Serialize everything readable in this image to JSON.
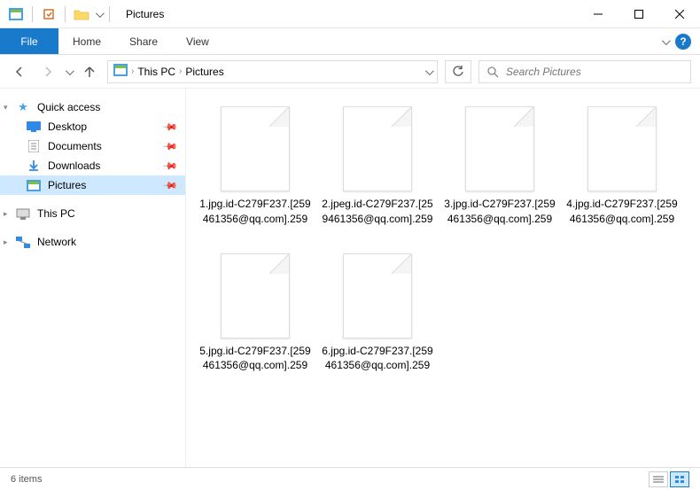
{
  "window": {
    "title": "Pictures"
  },
  "ribbon": {
    "file": "File",
    "tabs": [
      "Home",
      "Share",
      "View"
    ]
  },
  "breadcrumb": {
    "items": [
      "This PC",
      "Pictures"
    ]
  },
  "search": {
    "placeholder": "Search Pictures"
  },
  "sidebar": {
    "quick_access": "Quick access",
    "items": [
      {
        "icon": "desktop",
        "label": "Desktop",
        "pinned": true
      },
      {
        "icon": "documents",
        "label": "Documents",
        "pinned": true
      },
      {
        "icon": "downloads",
        "label": "Downloads",
        "pinned": true
      },
      {
        "icon": "pictures",
        "label": "Pictures",
        "pinned": true,
        "selected": true
      }
    ],
    "this_pc": "This PC",
    "network": "Network"
  },
  "files": [
    {
      "name": "1.jpg.id-C279F237.[259461356@qq.com].259"
    },
    {
      "name": "2.jpeg.id-C279F237.[259461356@qq.com].259"
    },
    {
      "name": "3.jpg.id-C279F237.[259461356@qq.com].259"
    },
    {
      "name": "4.jpg.id-C279F237.[259461356@qq.com].259"
    },
    {
      "name": "5.jpg.id-C279F237.[259461356@qq.com].259"
    },
    {
      "name": "6.jpg.id-C279F237.[259461356@qq.com].259"
    }
  ],
  "statusbar": {
    "count": "6 items"
  }
}
